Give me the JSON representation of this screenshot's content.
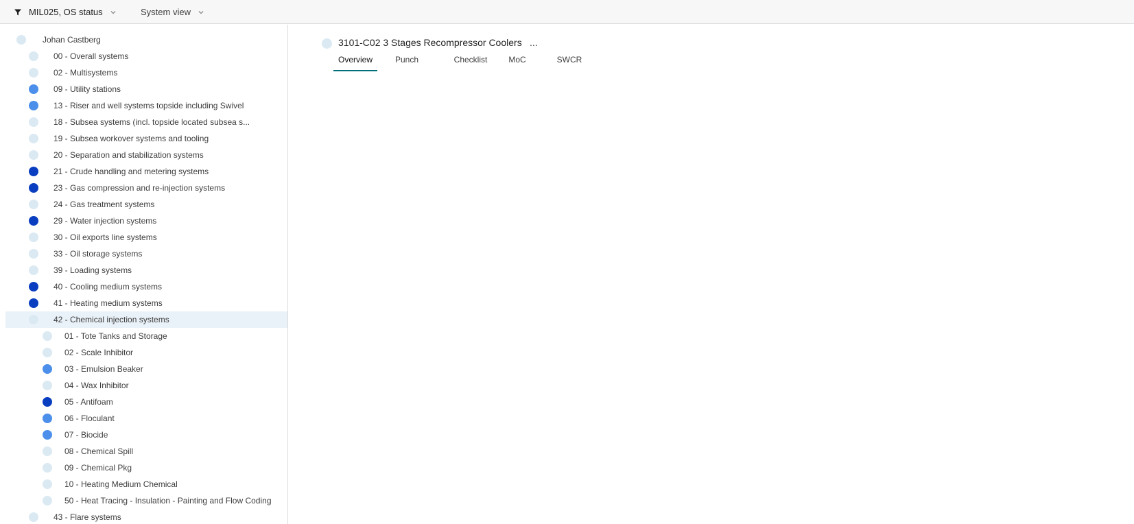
{
  "topbar": {
    "filter_label": "MIL025, OS status",
    "view_label": "System view"
  },
  "colors": {
    "status_light": "#dbe9f3",
    "status_medium": "#4c8fea",
    "status_dark": "#0a3ec0",
    "selected_row": "#eaf2f9",
    "tab_underline": "#007079"
  },
  "tree": {
    "root": {
      "label": "Johan Castberg",
      "status": "light"
    },
    "items": [
      {
        "label": "00 - Overall systems",
        "status": "light"
      },
      {
        "label": "02 - Multisystems",
        "status": "light"
      },
      {
        "label": "09 - Utility stations",
        "status": "medium"
      },
      {
        "label": "13 - Riser and well systems topside including Swivel",
        "status": "medium"
      },
      {
        "label": "18 - Subsea systems (incl. topside located subsea s...",
        "status": "light"
      },
      {
        "label": "19 - Subsea workover systems and tooling",
        "status": "light"
      },
      {
        "label": "20 - Separation and stabilization systems",
        "status": "light"
      },
      {
        "label": "21 - Crude handling and metering systems",
        "status": "dark"
      },
      {
        "label": "23 - Gas compression and re-injection systems",
        "status": "dark"
      },
      {
        "label": "24 - Gas treatment systems",
        "status": "light"
      },
      {
        "label": "29 - Water injection systems",
        "status": "dark"
      },
      {
        "label": "30 - Oil exports line systems",
        "status": "light"
      },
      {
        "label": "33 - Oil storage systems",
        "status": "light"
      },
      {
        "label": "39 - Loading systems",
        "status": "light"
      },
      {
        "label": "40 - Cooling medium systems",
        "status": "dark"
      },
      {
        "label": "41 - Heating medium systems",
        "status": "dark"
      },
      {
        "label": "42 - Chemical injection systems",
        "status": "light",
        "selected": true
      },
      {
        "label": "43 - Flare systems",
        "status": "light"
      }
    ],
    "children": [
      {
        "label": "01 - Tote Tanks and Storage",
        "status": "light"
      },
      {
        "label": "02 - Scale Inhibitor",
        "status": "light"
      },
      {
        "label": "03 - Emulsion Beaker",
        "status": "medium"
      },
      {
        "label": "04 - Wax Inhibitor",
        "status": "light"
      },
      {
        "label": "05 - Antifoam",
        "status": "dark"
      },
      {
        "label": "06 - Floculant",
        "status": "medium"
      },
      {
        "label": "07 - Biocide",
        "status": "medium"
      },
      {
        "label": "08 - Chemical Spill",
        "status": "light"
      },
      {
        "label": "09 - Chemical Pkg",
        "status": "light"
      },
      {
        "label": "10 - Heating Medium Chemical",
        "status": "light"
      },
      {
        "label": "50 - Heat Tracing - Insulation - Painting and Flow Coding",
        "status": "light"
      }
    ]
  },
  "detail": {
    "title": "3101-C02 3 Stages Recompressor Coolers",
    "more_label": "...",
    "status": "light",
    "tabs": [
      {
        "label": "Overview",
        "active": true
      },
      {
        "label": "Punch"
      },
      {
        "label": "Checklist"
      },
      {
        "label": "MoC"
      },
      {
        "label": "SWCR"
      }
    ]
  }
}
